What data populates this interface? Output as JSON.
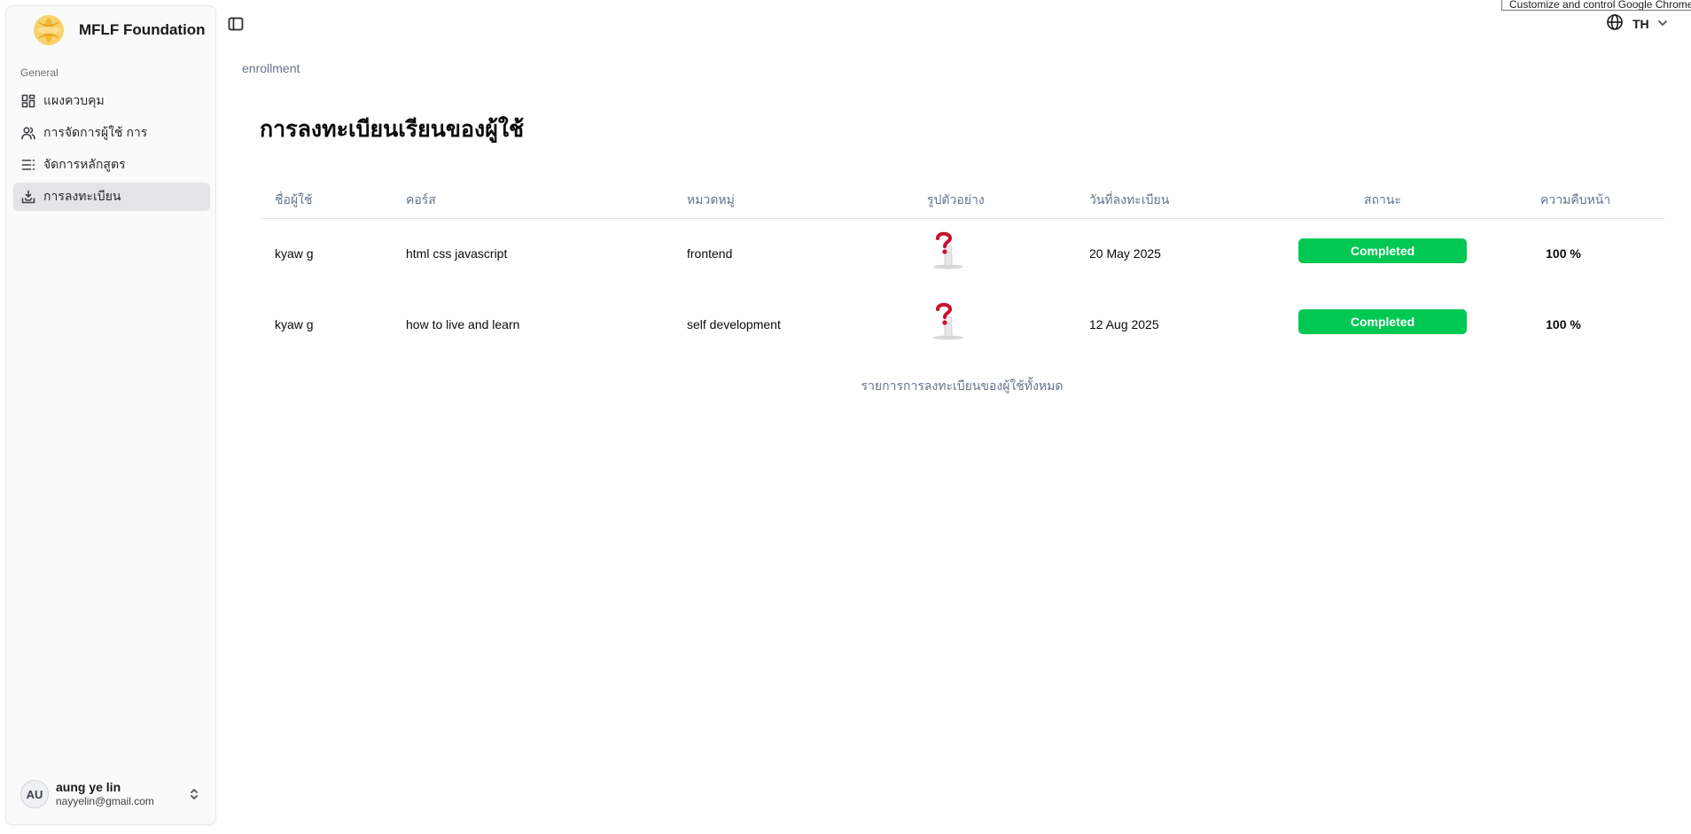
{
  "brand": {
    "name": "MFLF Foundation"
  },
  "sidebar": {
    "group_label": "General",
    "items": [
      {
        "label": "แผงควบคุม",
        "icon": "dashboard-icon"
      },
      {
        "label": "การจัดการผู้ใช้ การ",
        "icon": "users-icon"
      },
      {
        "label": "จัดการหลักสูตร",
        "icon": "list-icon"
      },
      {
        "label": "การลงทะเบียน",
        "icon": "inbox-download-icon",
        "active": true
      }
    ]
  },
  "user": {
    "initials": "AU",
    "name": "aung ye lin",
    "email": "nayyelin@gmail.com"
  },
  "topbar": {
    "language": "TH",
    "tooltip": "Customize and control Google Chrome"
  },
  "breadcrumb": "enrollment",
  "page": {
    "title": "การลงทะเบียนเรียนของผู้ใช้"
  },
  "table": {
    "headers": [
      "ชื่อผู้ใช้",
      "คอร์ส",
      "หมวดหมู่",
      "รูปตัวอย่าง",
      "วันที่ลงทะเบียน",
      "สถานะ",
      "ความคืบหน้า"
    ],
    "rows": [
      {
        "user": "kyaw g",
        "course": "html css javascript",
        "category": "frontend",
        "date": "20 May 2025",
        "status": "Completed",
        "progress": "100 %"
      },
      {
        "user": "kyaw g",
        "course": "how to live and learn",
        "category": "self development",
        "date": "12 Aug 2025",
        "status": "Completed",
        "progress": "100 %"
      }
    ],
    "caption": "รายการการลงทะเบียนของผู้ใช้ทั้งหมด"
  },
  "colors": {
    "status_completed": "#00c853",
    "sidebar_bg": "#fafafa",
    "active_item_bg": "#e4e4e7"
  }
}
